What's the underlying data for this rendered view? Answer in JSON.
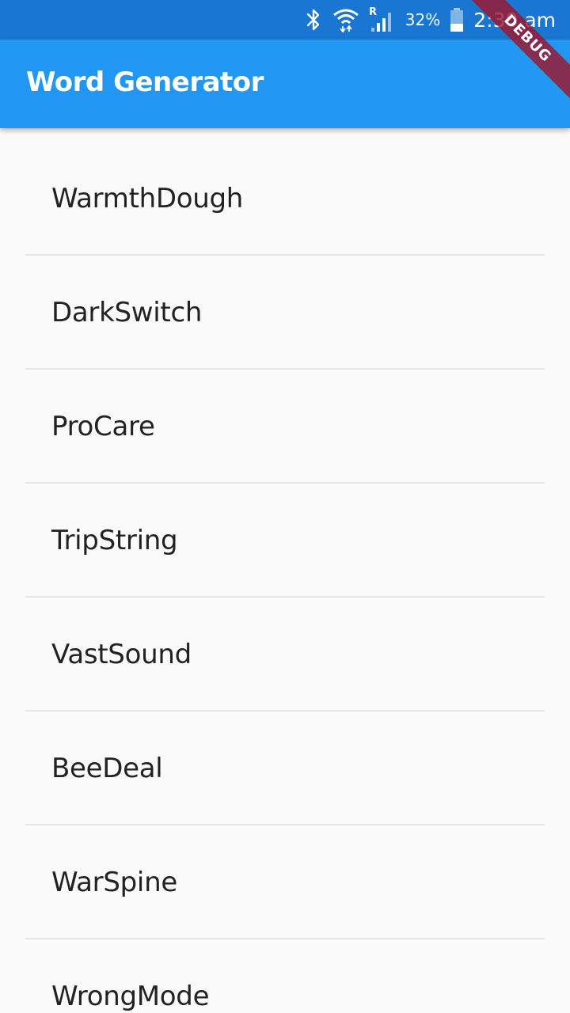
{
  "status_bar": {
    "battery_percent": "32%",
    "time": "2:30 am",
    "icons": [
      "bluetooth-icon",
      "wifi-icon",
      "signal-icon",
      "battery-icon"
    ],
    "color": "#1976d2"
  },
  "app_bar": {
    "title": "Word Generator",
    "color": "#2196f3"
  },
  "debug_banner": {
    "label": "DEBUG"
  },
  "words": [
    "WarmthDough",
    "DarkSwitch",
    "ProCare",
    "TripString",
    "VastSound",
    "BeeDeal",
    "WarSpine",
    "WrongMode"
  ]
}
